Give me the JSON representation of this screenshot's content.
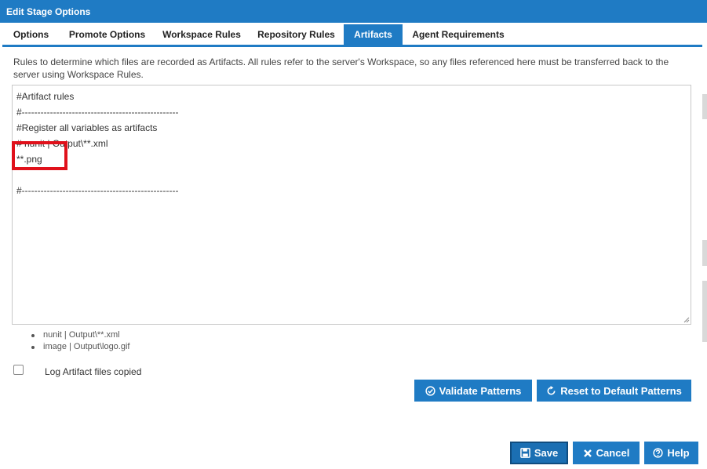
{
  "dialog": {
    "title": "Edit Stage Options"
  },
  "tabs": [
    {
      "label": "Options",
      "active": false
    },
    {
      "label": "Promote Options",
      "active": false
    },
    {
      "label": "Workspace Rules",
      "active": false
    },
    {
      "label": "Repository Rules",
      "active": false
    },
    {
      "label": "Artifacts",
      "active": true
    },
    {
      "label": "Agent Requirements",
      "active": false
    }
  ],
  "description": "Rules to determine which files are recorded as Artifacts. All rules refer to the server's Workspace, so any files referenced here must be transferred back to the server using Workspace Rules.",
  "rules_editor": {
    "lines": [
      "#Artifact rules",
      "#--------------------------------------------------",
      "#Register all variables as artifacts",
      "# nunit | Output\\**.xml",
      "**.png",
      "",
      "#--------------------------------------------------"
    ]
  },
  "examples": [
    "nunit | Output\\**.xml",
    "image | Output\\logo.gif"
  ],
  "log_artifacts": {
    "label": "Log Artifact files copied",
    "checked": false
  },
  "buttons": {
    "validate": "Validate Patterns",
    "reset": "Reset to Default Patterns",
    "save": "Save",
    "cancel": "Cancel",
    "help": "Help"
  },
  "colors": {
    "primary": "#1f7bc4",
    "highlight": "#e0111b"
  }
}
